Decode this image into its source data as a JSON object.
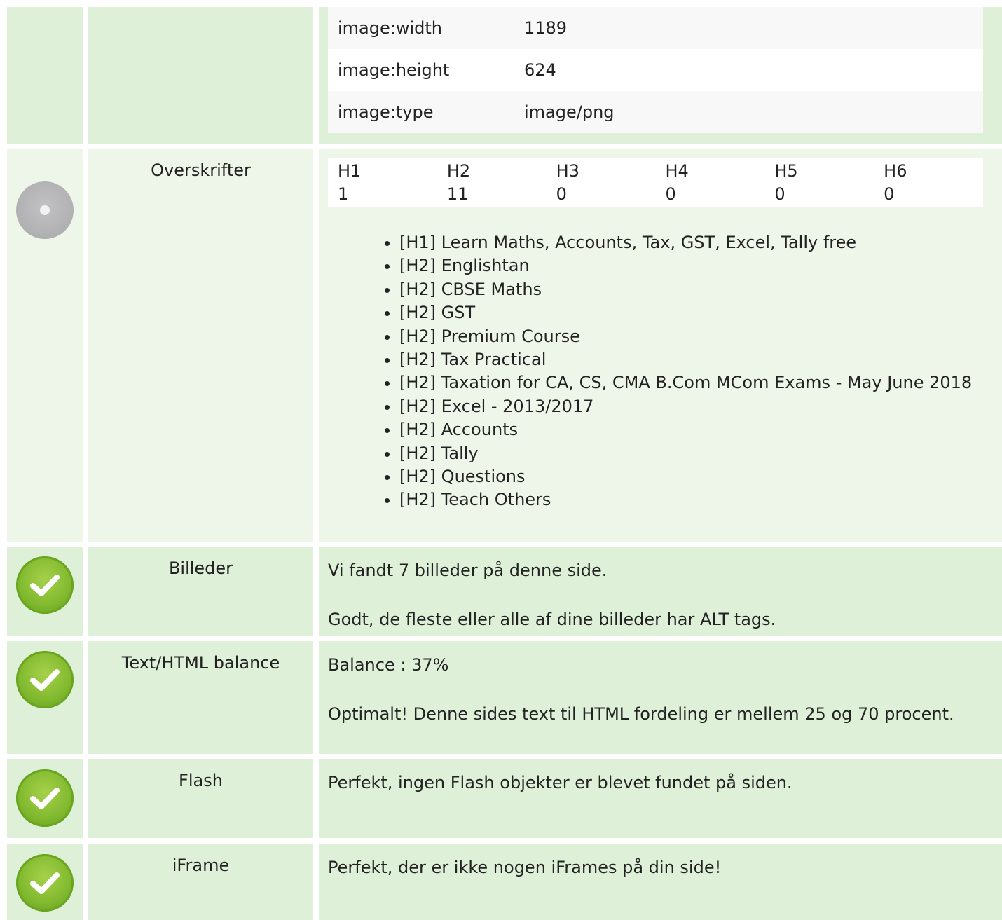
{
  "meta_rows": [
    {
      "key": "image:width",
      "value": "1189"
    },
    {
      "key": "image:height",
      "value": "624"
    },
    {
      "key": "image:type",
      "value": "image/png"
    }
  ],
  "headings": {
    "label": "Overskrifter",
    "icon": "neutral-circle-icon",
    "columns": [
      "H1",
      "H2",
      "H3",
      "H4",
      "H5",
      "H6"
    ],
    "counts": [
      "1",
      "11",
      "0",
      "0",
      "0",
      "0"
    ],
    "list": [
      "[H1] Learn Maths, Accounts, Tax, GST, Excel, Tally free",
      "[H2] Englishtan",
      "[H2] CBSE Maths",
      "[H2] GST",
      "[H2] Premium Course",
      "[H2] Tax Practical",
      "[H2] Taxation for CA, CS, CMA B.Com MCom Exams - May June 2018",
      "[H2] Excel - 2013/2017",
      "[H2] Accounts",
      "[H2] Tally",
      "[H2] Questions",
      "[H2] Teach Others"
    ]
  },
  "images": {
    "label": "Billeder",
    "icon": "check-circle-icon",
    "line1": "Vi fandt 7 billeder på denne side.",
    "line2": "Godt, de fleste eller alle af dine billeder har ALT tags."
  },
  "balance": {
    "label": "Text/HTML balance",
    "icon": "check-circle-icon",
    "line1": "Balance : 37%",
    "line2": "Optimalt! Denne sides text til HTML fordeling er mellem 25 og 70 procent."
  },
  "flash": {
    "label": "Flash",
    "icon": "check-circle-icon",
    "line1": "Perfekt, ingen Flash objekter er blevet fundet på siden."
  },
  "iframe": {
    "label": "iFrame",
    "icon": "check-circle-icon",
    "line1": "Perfekt, der er ikke nogen iFrames på din side!"
  },
  "colors": {
    "row_bg": "#dff0d8",
    "ok_green": "#7fb82e",
    "neutral_grey": "#b0b0b2"
  }
}
